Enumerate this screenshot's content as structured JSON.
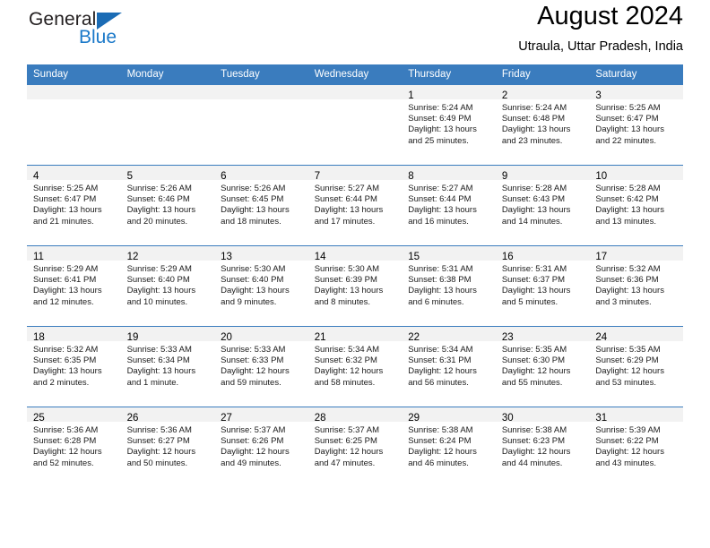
{
  "brand": {
    "name_top": "General",
    "name_bottom": "Blue",
    "triangle_color": "#1b6cb5",
    "top_color": "#231f20",
    "bottom_color": "#1b79c9"
  },
  "header": {
    "title": "August 2024",
    "subtitle": "Utraula, Uttar Pradesh, India"
  },
  "theme": {
    "header_bg": "#3a7cbe",
    "header_text": "#ffffff",
    "daynum_band_bg": "#f2f2f2",
    "row_divider": "#3a7cbe"
  },
  "weekday_headers": [
    "Sunday",
    "Monday",
    "Tuesday",
    "Wednesday",
    "Thursday",
    "Friday",
    "Saturday"
  ],
  "weeks": [
    [
      {
        "day": "",
        "lines": []
      },
      {
        "day": "",
        "lines": []
      },
      {
        "day": "",
        "lines": []
      },
      {
        "day": "",
        "lines": []
      },
      {
        "day": "1",
        "lines": [
          "Sunrise: 5:24 AM",
          "Sunset: 6:49 PM",
          "Daylight: 13 hours",
          "and 25 minutes."
        ]
      },
      {
        "day": "2",
        "lines": [
          "Sunrise: 5:24 AM",
          "Sunset: 6:48 PM",
          "Daylight: 13 hours",
          "and 23 minutes."
        ]
      },
      {
        "day": "3",
        "lines": [
          "Sunrise: 5:25 AM",
          "Sunset: 6:47 PM",
          "Daylight: 13 hours",
          "and 22 minutes."
        ]
      }
    ],
    [
      {
        "day": "4",
        "lines": [
          "Sunrise: 5:25 AM",
          "Sunset: 6:47 PM",
          "Daylight: 13 hours",
          "and 21 minutes."
        ]
      },
      {
        "day": "5",
        "lines": [
          "Sunrise: 5:26 AM",
          "Sunset: 6:46 PM",
          "Daylight: 13 hours",
          "and 20 minutes."
        ]
      },
      {
        "day": "6",
        "lines": [
          "Sunrise: 5:26 AM",
          "Sunset: 6:45 PM",
          "Daylight: 13 hours",
          "and 18 minutes."
        ]
      },
      {
        "day": "7",
        "lines": [
          "Sunrise: 5:27 AM",
          "Sunset: 6:44 PM",
          "Daylight: 13 hours",
          "and 17 minutes."
        ]
      },
      {
        "day": "8",
        "lines": [
          "Sunrise: 5:27 AM",
          "Sunset: 6:44 PM",
          "Daylight: 13 hours",
          "and 16 minutes."
        ]
      },
      {
        "day": "9",
        "lines": [
          "Sunrise: 5:28 AM",
          "Sunset: 6:43 PM",
          "Daylight: 13 hours",
          "and 14 minutes."
        ]
      },
      {
        "day": "10",
        "lines": [
          "Sunrise: 5:28 AM",
          "Sunset: 6:42 PM",
          "Daylight: 13 hours",
          "and 13 minutes."
        ]
      }
    ],
    [
      {
        "day": "11",
        "lines": [
          "Sunrise: 5:29 AM",
          "Sunset: 6:41 PM",
          "Daylight: 13 hours",
          "and 12 minutes."
        ]
      },
      {
        "day": "12",
        "lines": [
          "Sunrise: 5:29 AM",
          "Sunset: 6:40 PM",
          "Daylight: 13 hours",
          "and 10 minutes."
        ]
      },
      {
        "day": "13",
        "lines": [
          "Sunrise: 5:30 AM",
          "Sunset: 6:40 PM",
          "Daylight: 13 hours",
          "and 9 minutes."
        ]
      },
      {
        "day": "14",
        "lines": [
          "Sunrise: 5:30 AM",
          "Sunset: 6:39 PM",
          "Daylight: 13 hours",
          "and 8 minutes."
        ]
      },
      {
        "day": "15",
        "lines": [
          "Sunrise: 5:31 AM",
          "Sunset: 6:38 PM",
          "Daylight: 13 hours",
          "and 6 minutes."
        ]
      },
      {
        "day": "16",
        "lines": [
          "Sunrise: 5:31 AM",
          "Sunset: 6:37 PM",
          "Daylight: 13 hours",
          "and 5 minutes."
        ]
      },
      {
        "day": "17",
        "lines": [
          "Sunrise: 5:32 AM",
          "Sunset: 6:36 PM",
          "Daylight: 13 hours",
          "and 3 minutes."
        ]
      }
    ],
    [
      {
        "day": "18",
        "lines": [
          "Sunrise: 5:32 AM",
          "Sunset: 6:35 PM",
          "Daylight: 13 hours",
          "and 2 minutes."
        ]
      },
      {
        "day": "19",
        "lines": [
          "Sunrise: 5:33 AM",
          "Sunset: 6:34 PM",
          "Daylight: 13 hours",
          "and 1 minute."
        ]
      },
      {
        "day": "20",
        "lines": [
          "Sunrise: 5:33 AM",
          "Sunset: 6:33 PM",
          "Daylight: 12 hours",
          "and 59 minutes."
        ]
      },
      {
        "day": "21",
        "lines": [
          "Sunrise: 5:34 AM",
          "Sunset: 6:32 PM",
          "Daylight: 12 hours",
          "and 58 minutes."
        ]
      },
      {
        "day": "22",
        "lines": [
          "Sunrise: 5:34 AM",
          "Sunset: 6:31 PM",
          "Daylight: 12 hours",
          "and 56 minutes."
        ]
      },
      {
        "day": "23",
        "lines": [
          "Sunrise: 5:35 AM",
          "Sunset: 6:30 PM",
          "Daylight: 12 hours",
          "and 55 minutes."
        ]
      },
      {
        "day": "24",
        "lines": [
          "Sunrise: 5:35 AM",
          "Sunset: 6:29 PM",
          "Daylight: 12 hours",
          "and 53 minutes."
        ]
      }
    ],
    [
      {
        "day": "25",
        "lines": [
          "Sunrise: 5:36 AM",
          "Sunset: 6:28 PM",
          "Daylight: 12 hours",
          "and 52 minutes."
        ]
      },
      {
        "day": "26",
        "lines": [
          "Sunrise: 5:36 AM",
          "Sunset: 6:27 PM",
          "Daylight: 12 hours",
          "and 50 minutes."
        ]
      },
      {
        "day": "27",
        "lines": [
          "Sunrise: 5:37 AM",
          "Sunset: 6:26 PM",
          "Daylight: 12 hours",
          "and 49 minutes."
        ]
      },
      {
        "day": "28",
        "lines": [
          "Sunrise: 5:37 AM",
          "Sunset: 6:25 PM",
          "Daylight: 12 hours",
          "and 47 minutes."
        ]
      },
      {
        "day": "29",
        "lines": [
          "Sunrise: 5:38 AM",
          "Sunset: 6:24 PM",
          "Daylight: 12 hours",
          "and 46 minutes."
        ]
      },
      {
        "day": "30",
        "lines": [
          "Sunrise: 5:38 AM",
          "Sunset: 6:23 PM",
          "Daylight: 12 hours",
          "and 44 minutes."
        ]
      },
      {
        "day": "31",
        "lines": [
          "Sunrise: 5:39 AM",
          "Sunset: 6:22 PM",
          "Daylight: 12 hours",
          "and 43 minutes."
        ]
      }
    ]
  ]
}
